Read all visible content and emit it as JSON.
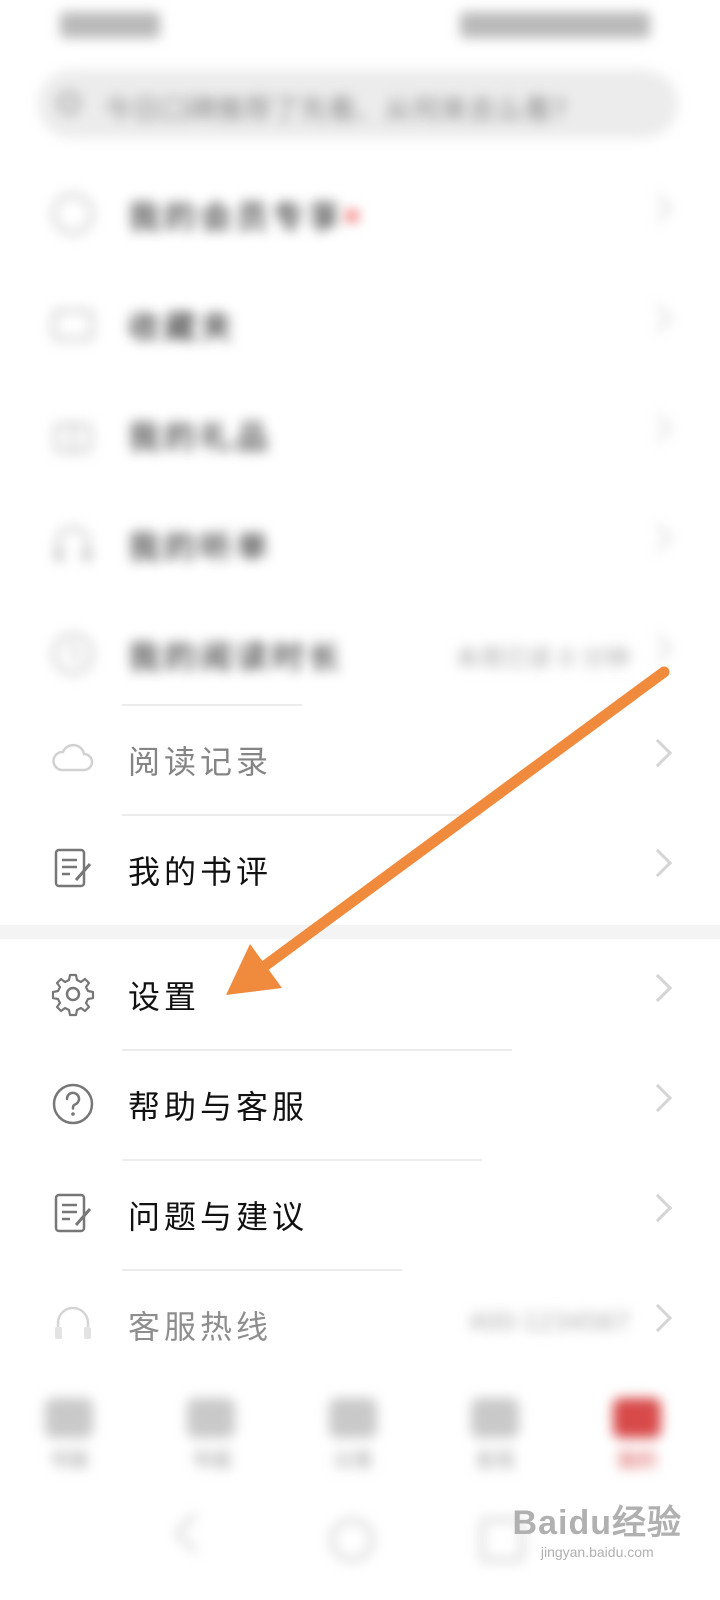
{
  "status_bar": {
    "left": "",
    "right": ""
  },
  "search": {
    "placeholder": "今日口碑推荐了先看、从何来去么看?"
  },
  "menu": {
    "blurred_items": [
      {
        "label": "我的会员专享"
      },
      {
        "label": "收藏夹"
      },
      {
        "label": "我的礼品"
      },
      {
        "label": "我的听单"
      },
      {
        "label": "我的阅读时长",
        "value": "本周已读 0 分钟"
      }
    ],
    "reading_record": "阅读记录",
    "my_reviews": "我的书评",
    "settings": "设置",
    "help": "帮助与客服",
    "feedback": "问题与建议",
    "hotline": "客服热线",
    "hotline_number": "400-1234567"
  },
  "tabbar": {
    "tabs": [
      {
        "label": "书架"
      },
      {
        "label": "书城"
      },
      {
        "label": "分类"
      },
      {
        "label": "发现"
      },
      {
        "label": "我的"
      }
    ]
  },
  "accent": "#f08a3c",
  "watermark": {
    "brand": "Baidu经验",
    "url": "jingyan.baidu.com"
  }
}
